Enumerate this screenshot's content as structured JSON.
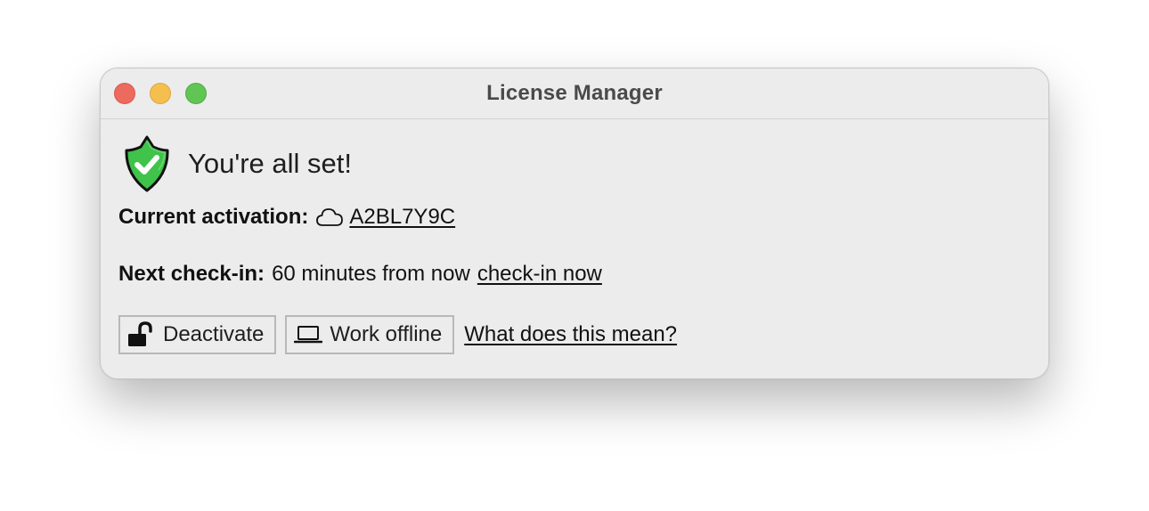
{
  "window": {
    "title": "License Manager"
  },
  "status": {
    "headline": "You're all set!",
    "icon": "green-shield-check-icon",
    "accent_color": "#3fc34a"
  },
  "activation": {
    "label": "Current activation:",
    "icon": "cloud-icon",
    "code": "A2BL7Y9C"
  },
  "checkin": {
    "label": "Next check-in:",
    "value": "60 minutes from now",
    "action": "check-in now"
  },
  "actions": {
    "deactivate_label": "Deactivate",
    "deactivate_icon": "unlocked-padlock-icon",
    "offline_label": "Work offline",
    "offline_icon": "laptop-icon",
    "help_link": "What does this mean?"
  }
}
